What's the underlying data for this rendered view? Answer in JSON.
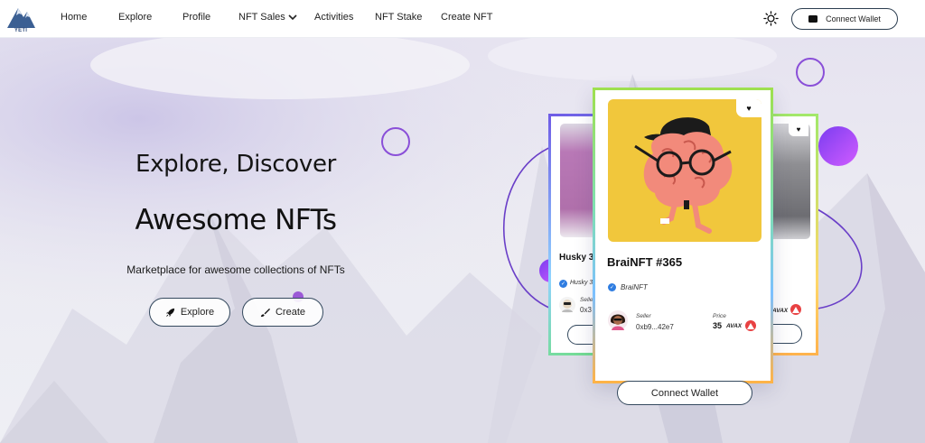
{
  "logo": {
    "text": "YETI"
  },
  "nav": {
    "items": [
      {
        "label": "Home"
      },
      {
        "label": "Explore"
      },
      {
        "label": "Profile"
      },
      {
        "label": "NFT Sales"
      },
      {
        "label": "Activities"
      },
      {
        "label": "NFT Stake"
      },
      {
        "label": "Create NFT"
      }
    ],
    "connect_wallet": "Connect Wallet"
  },
  "hero": {
    "subtitle": "Explore, Discover",
    "title": "Awesome NFTs",
    "description": "Marketplace for awesome collections of NFTs",
    "explore_button": "Explore",
    "create_button": "Create"
  },
  "cards": {
    "main": {
      "title": "BraiNFT #365",
      "collection": "BraiNFT",
      "seller_label": "Seller",
      "seller": "0xb9...42e7",
      "price_label": "Price",
      "price": "35",
      "currency": "AVAX",
      "button": "Connect Wallet"
    },
    "left": {
      "title": "Husky 3D",
      "collection": "Husky 3D",
      "seller_label": "Seller",
      "seller": "0x3"
    },
    "right": {
      "price_label": "e",
      "currency": "AVAX"
    }
  },
  "colors": {
    "accent_purple": "#9b59d6",
    "avax_red": "#e84142",
    "verify_blue": "#2f7de1",
    "nft_bg_yellow": "#f1c73c"
  }
}
